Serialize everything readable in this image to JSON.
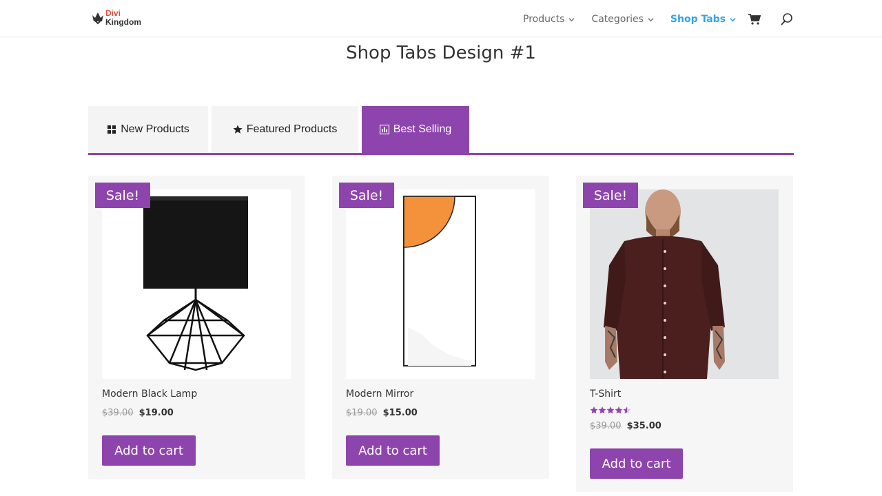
{
  "brand": {
    "line1": "Divi",
    "line2": "Kingdom"
  },
  "nav": {
    "items": [
      {
        "label": "Products"
      },
      {
        "label": "Categories"
      },
      {
        "label": "Shop Tabs"
      }
    ]
  },
  "page_title": "Shop Tabs Design #1",
  "tabs": [
    {
      "label": "New Products",
      "icon": "grid-icon"
    },
    {
      "label": "Featured Products",
      "icon": "star-icon"
    },
    {
      "label": "Best Selling",
      "icon": "bar-chart-icon"
    }
  ],
  "products": [
    {
      "sale": "Sale!",
      "name": "Modern Black Lamp",
      "old_price": "$39.00",
      "price": "$19.00",
      "button": "Add to cart"
    },
    {
      "sale": "Sale!",
      "name": "Modern Mirror",
      "old_price": "$19.00",
      "price": "$15.00",
      "button": "Add to cart"
    },
    {
      "sale": "Sale!",
      "name": "T-Shirt",
      "old_price": "$39.00",
      "price": "$35.00",
      "button": "Add to cart",
      "rating": 4.5
    }
  ],
  "colors": {
    "accent": "#8e44ad",
    "link": "#2ea3f2"
  }
}
